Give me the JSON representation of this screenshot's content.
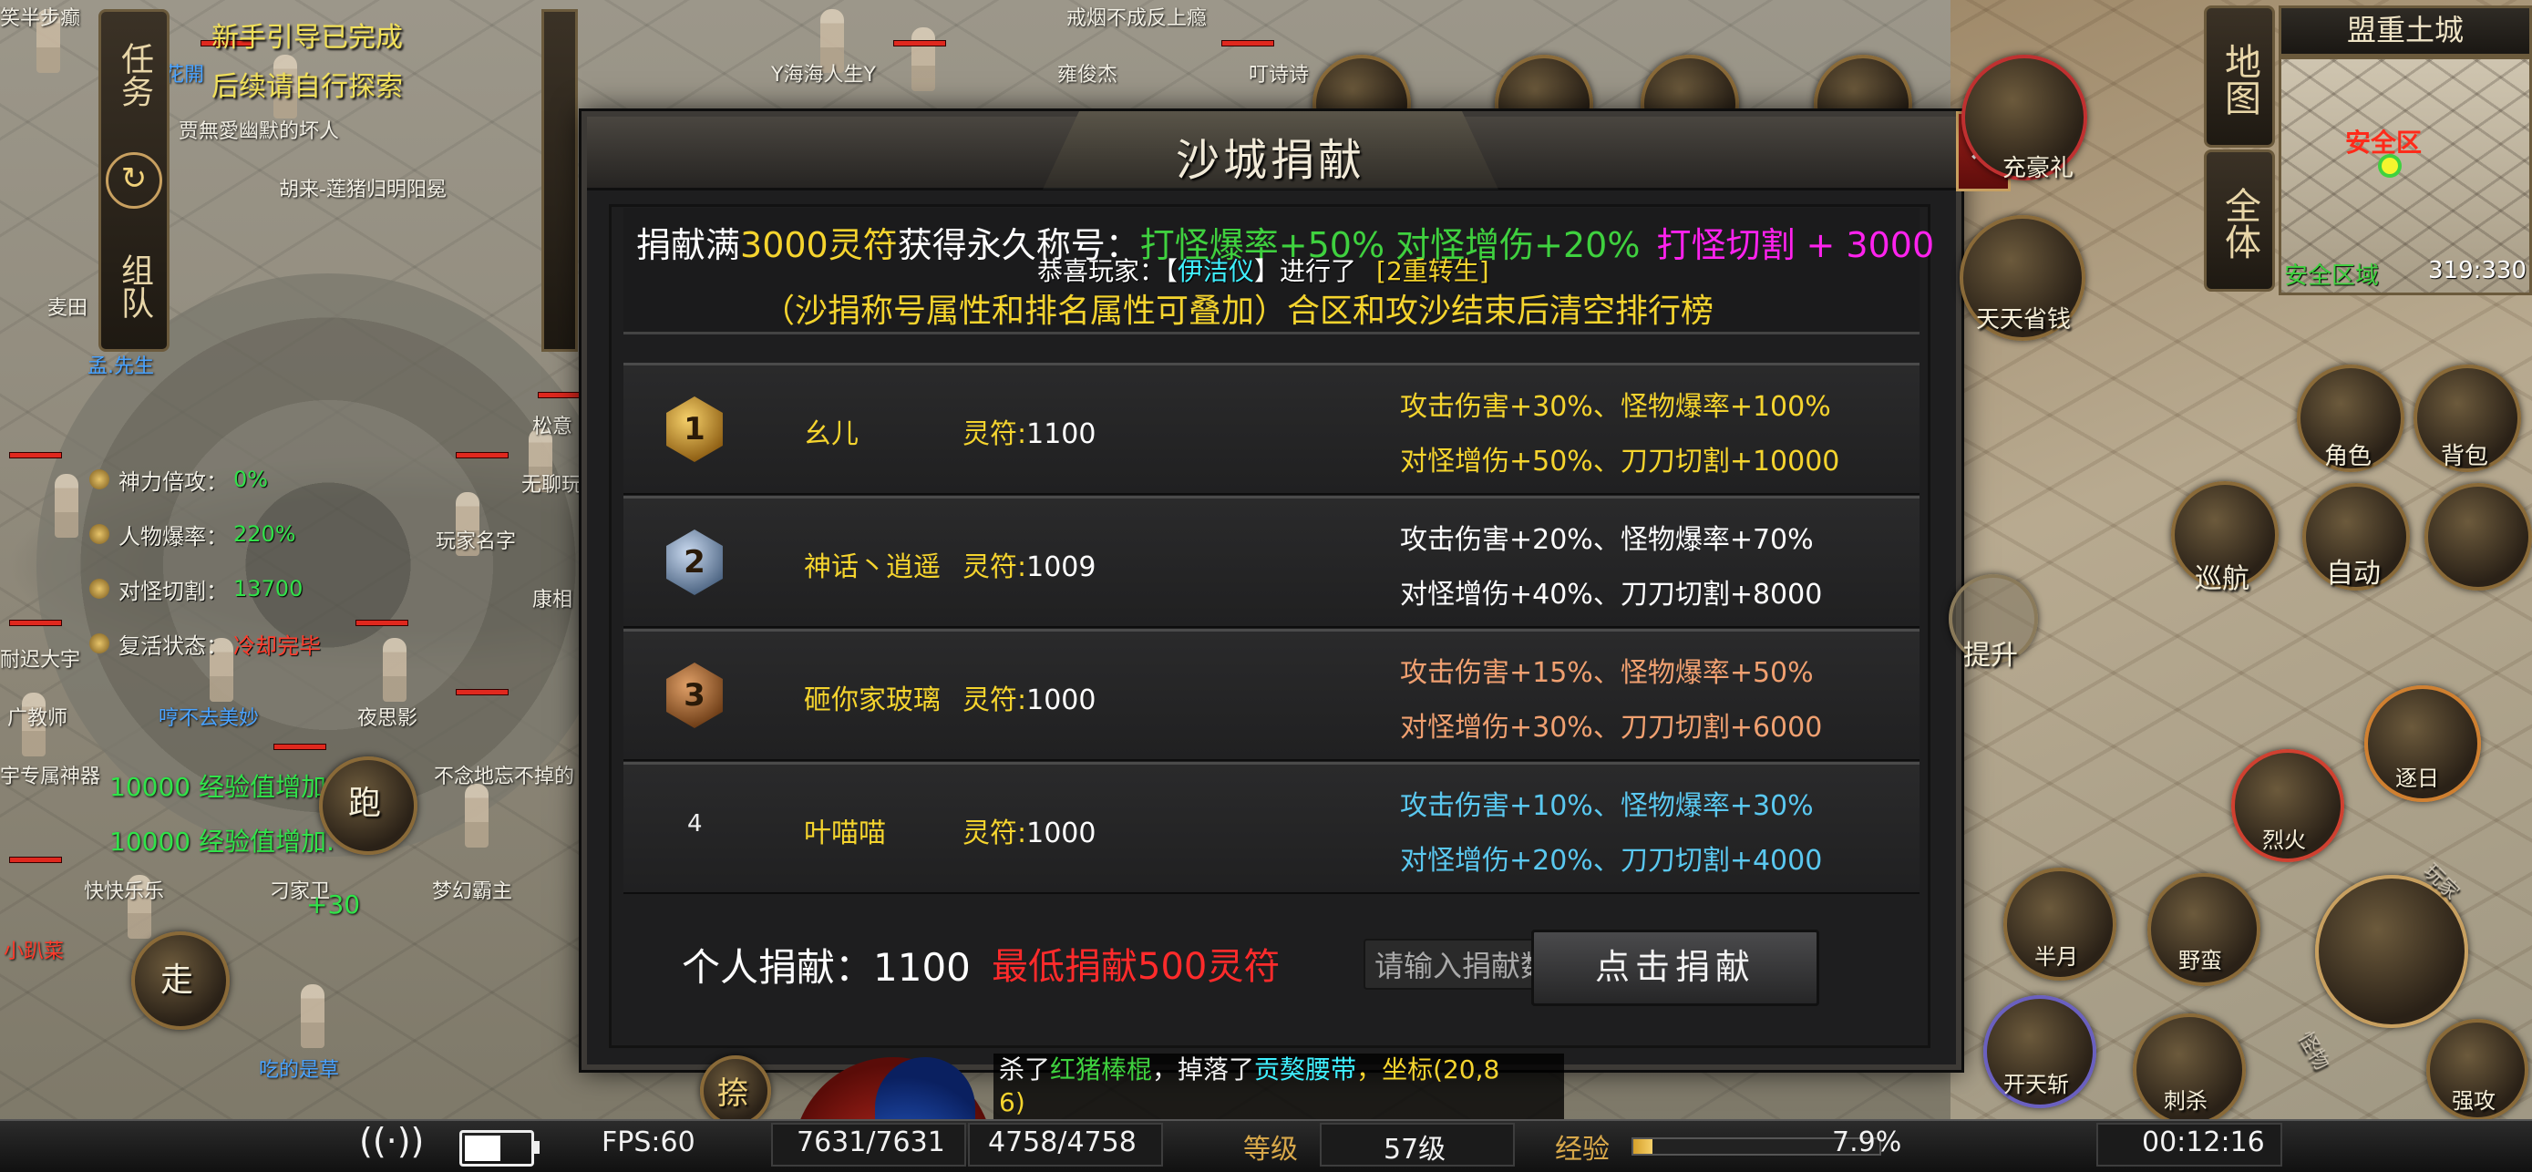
{
  "quest": {
    "tab_label": "任务",
    "team_label": "组队",
    "line1": "新手引导已完成",
    "line2": "后续请自行探索"
  },
  "buffs": [
    {
      "label": "神力倍攻：",
      "value": "0%"
    },
    {
      "label": "人物爆率：",
      "value": "220%"
    },
    {
      "label": "对怪切割：",
      "value": "13700"
    },
    {
      "label": "复活状态：",
      "value": "冷却完毕"
    }
  ],
  "world_labels": {
    "top_left": "笑半步癫",
    "n1": "戒烟不成反上瘾",
    "n2": "Y海海人生Y",
    "n3": "雍俊杰",
    "n4": "叮诗诗",
    "n5": "贾無愛幽默的坏人",
    "n6": "胡来-莲猪归明阳冕",
    "n7": "孟.先生",
    "n8": "麦田",
    "n9": "玩家名字",
    "n10": "松意",
    "n11": "无聊玩",
    "n12": "康相",
    "n13": "耐迟大宇",
    "n14": "广教师",
    "n15": "哼不去美妙",
    "n16": "夜思影",
    "n17": "不念地忘不掉的",
    "n18": "宇专属神器",
    "n19": "快快乐乐",
    "n20": "刁家卫",
    "n21": "梦幻霸主",
    "n22": "小趴菜",
    "n23": "吃的是草",
    "exp1": "10000 经验值增加.",
    "exp2": "10000 经验值增加.",
    "dmg": "+30",
    "run": "跑",
    "walk": "走",
    "chat_left": "花開"
  },
  "dialog": {
    "title": "沙城捐献",
    "close": "✕",
    "notice_a": "捐献满",
    "notice_b": "3000灵符",
    "notice_c": "获得永久称号：",
    "notice_d": "打怪爆率+50% 对怪增伤+20%",
    "notice_e": "打怪切割 + 3000",
    "congrats_a": "恭喜玩家：【",
    "congrats_player": "伊洁仪",
    "congrats_b": "】进行了",
    "congrats_event": "[2重转生]",
    "subnote": "（沙捐称号属性和排名属性可叠加）合区和攻沙结束后清空排行榜",
    "personal_label": "个人捐献：",
    "personal_value": "1100",
    "min_note": "最低捐献500灵符",
    "input_placeholder": "请输入捐献数量",
    "donate_button": "点击捐献",
    "lingfu_label": "灵符:",
    "ranks": [
      {
        "rank": "1",
        "name": "幺儿",
        "amount": "1100",
        "line1": "攻击伤害+30%、怪物爆率+100%",
        "line2": "对怪增伤+50%、刀刀切割+10000",
        "color": "#f5d42e",
        "badge": "gold"
      },
      {
        "rank": "2",
        "name": "神话丶逍遥",
        "amount": "1009",
        "line1": "攻击伤害+20%、怪物爆率+70%",
        "line2": "对怪增伤+40%、刀刀切割+8000",
        "color": "#ffffff",
        "badge": "silver"
      },
      {
        "rank": "3",
        "name": "砸你家玻璃",
        "amount": "1000",
        "line1": "攻击伤害+15%、怪物爆率+50%",
        "line2": "对怪增伤+30%、刀刀切割+6000",
        "color": "#f0a070",
        "badge": "bronze"
      },
      {
        "rank": "4",
        "name": "叶喵喵",
        "amount": "1000",
        "line1": "攻击伤害+10%、怪物爆率+30%",
        "line2": "对怪增伤+20%、刀刀切割+4000",
        "color": "#5ac8f0",
        "badge": "none"
      }
    ]
  },
  "minimap": {
    "title": "盟重土城",
    "safe_label": "安全区",
    "zone": "安全区域",
    "coord": "319:330",
    "tab_map": "地图",
    "tab_all": "全体"
  },
  "right_buttons": {
    "recharge": "充豪礼",
    "daily": "天天省钱",
    "character": "角色",
    "bag": "背包",
    "patrol": "巡航",
    "auto": "自动",
    "upgrade": "提升"
  },
  "skills": {
    "s1": "逐日",
    "s2": "烈火",
    "s3": "半月",
    "s4": "野蛮",
    "s5": "开天斩",
    "s6": "刺杀",
    "s7": "强攻",
    "side1": "玩家",
    "side2": "怪物"
  },
  "chat": {
    "a": "杀了",
    "b": "红猪棒棍",
    "c": "，掉落了",
    "d": "贡獒腰带",
    "e": "，坐标(20,8",
    "f": "6)"
  },
  "bottom_left_btn": "捺",
  "status": {
    "fps": "FPS:60",
    "hp": "7631/7631",
    "mp": "4758/4758",
    "level_label": "等级",
    "level": "57级",
    "exp_label": "经验",
    "exp_pct": "7.9%",
    "exp_fraction": 0.079,
    "battery_fraction": 0.55,
    "time": "00:12:16"
  }
}
